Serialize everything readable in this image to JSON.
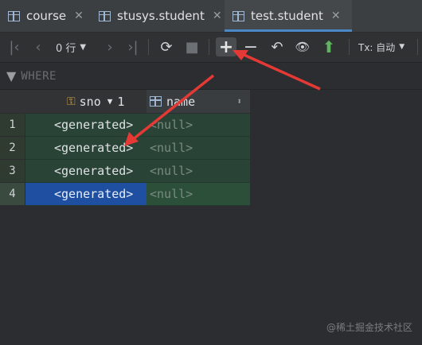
{
  "tabs": [
    {
      "label": "course",
      "close": "✕"
    },
    {
      "label": "stusys.student",
      "close": "✕"
    },
    {
      "label": "test.student",
      "close": "✕"
    }
  ],
  "toolbar": {
    "rows_label": "0 行",
    "tx_label": "Tx: 自动"
  },
  "filter": {
    "placeholder": "WHERE"
  },
  "columns": [
    {
      "name": "sno",
      "extra": "1"
    },
    {
      "name": "name"
    }
  ],
  "rows": [
    {
      "num": "1",
      "sno": "<generated>",
      "name": "<null>"
    },
    {
      "num": "2",
      "sno": "<generated>",
      "name": "<null>"
    },
    {
      "num": "3",
      "sno": "<generated>",
      "name": "<null>"
    },
    {
      "num": "4",
      "sno": "<generated>",
      "name": "<null>"
    }
  ],
  "watermark": "@稀土掘金技术社区",
  "colors": {
    "accent": "#4a88c7",
    "new_row_bg": "#294436",
    "selected_cell": "#1f4fa0",
    "arrow": "#e53935"
  }
}
